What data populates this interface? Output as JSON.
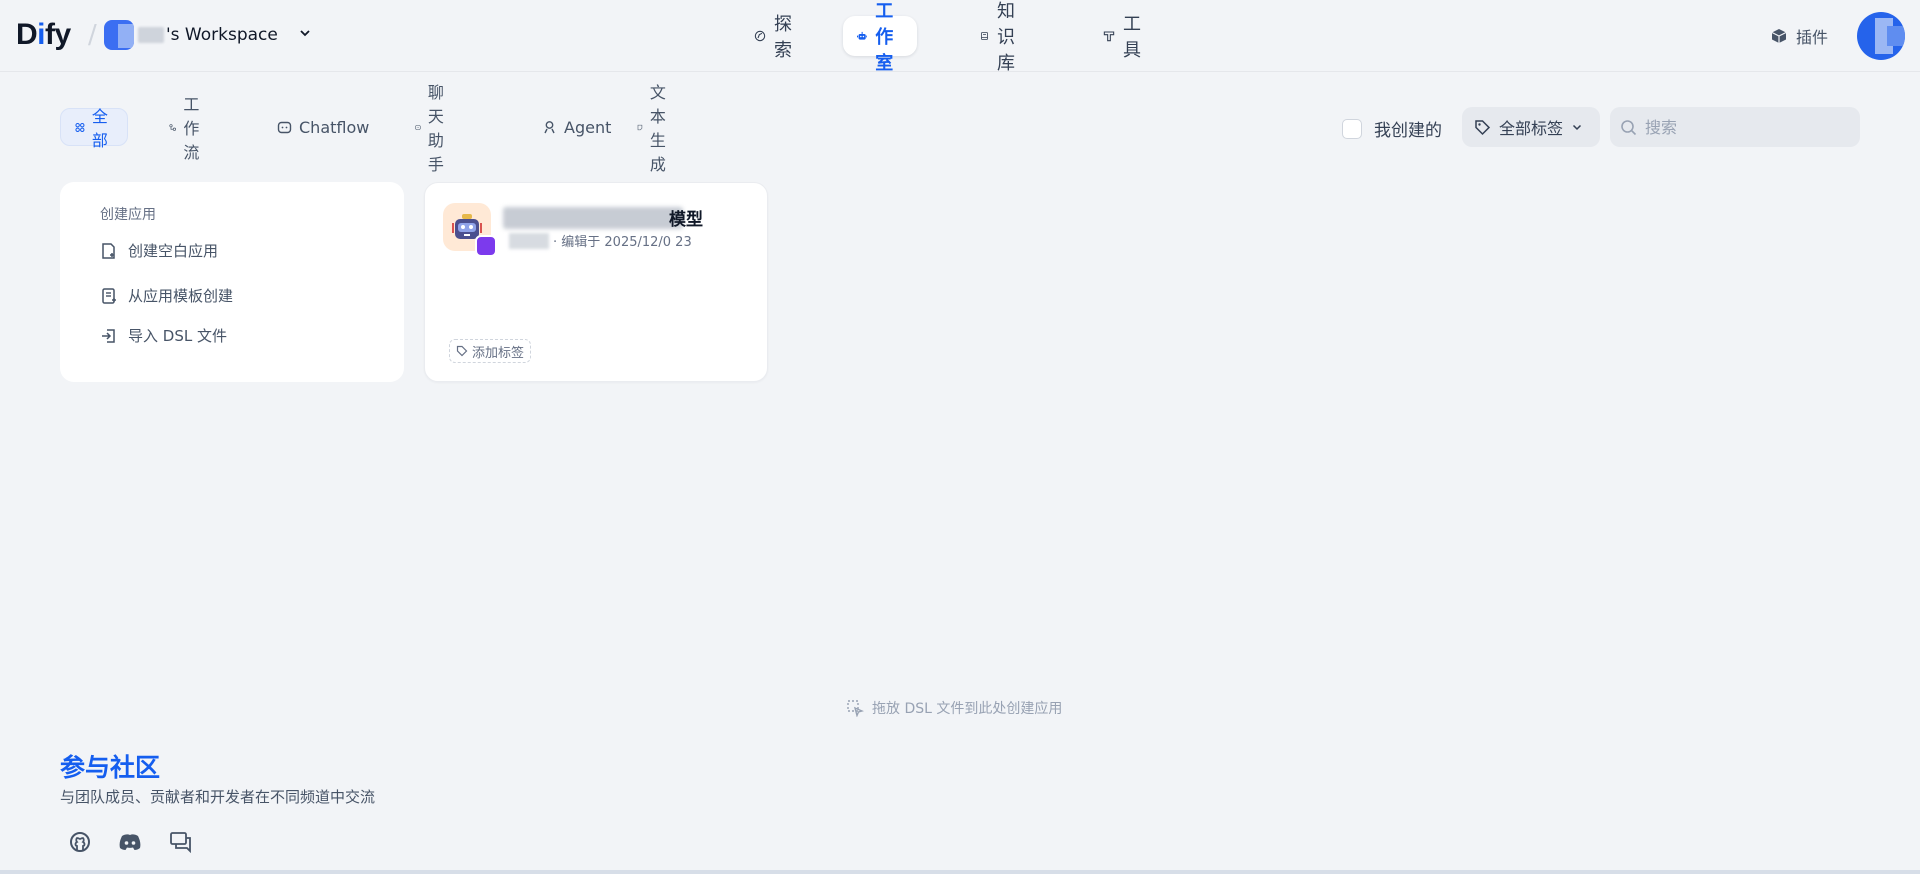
{
  "header": {
    "logo_prefix": "D",
    "logo_highlight": "i",
    "logo_suffix": "fy",
    "workspace_name": "'s Workspace",
    "nav": [
      {
        "label": "探索",
        "icon": "compass-icon"
      },
      {
        "label": "工作室",
        "icon": "robot-icon",
        "active": true
      },
      {
        "label": "知识库",
        "icon": "book-icon"
      },
      {
        "label": "工具",
        "icon": "hammer-icon"
      }
    ],
    "plugins_label": "插件"
  },
  "filters": {
    "tabs": [
      {
        "label": "全部",
        "active": true
      },
      {
        "label": "工作流"
      },
      {
        "label": "Chatflow"
      },
      {
        "label": "聊天助手"
      },
      {
        "label": "Agent"
      },
      {
        "label": "文本生成"
      }
    ],
    "created_by_me_label": "我创建的",
    "tags_label": "全部标签",
    "search_placeholder": "搜索"
  },
  "create_card": {
    "title": "创建应用",
    "items": [
      {
        "label": "创建空白应用"
      },
      {
        "label": "从应用模板创建"
      },
      {
        "label": "导入 DSL 文件"
      }
    ]
  },
  "app_card": {
    "name": "模型",
    "edited": "· 编辑于 2025/12/0   23",
    "add_tag_label": "添加标签"
  },
  "drop_hint": "拖放 DSL 文件到此处创建应用",
  "community": {
    "title": "参与社区",
    "subtitle": "与团队成员、贡献者和开发者在不同频道中交流"
  },
  "colors": {
    "accent": "#155eef",
    "background": "#f2f4f7"
  }
}
